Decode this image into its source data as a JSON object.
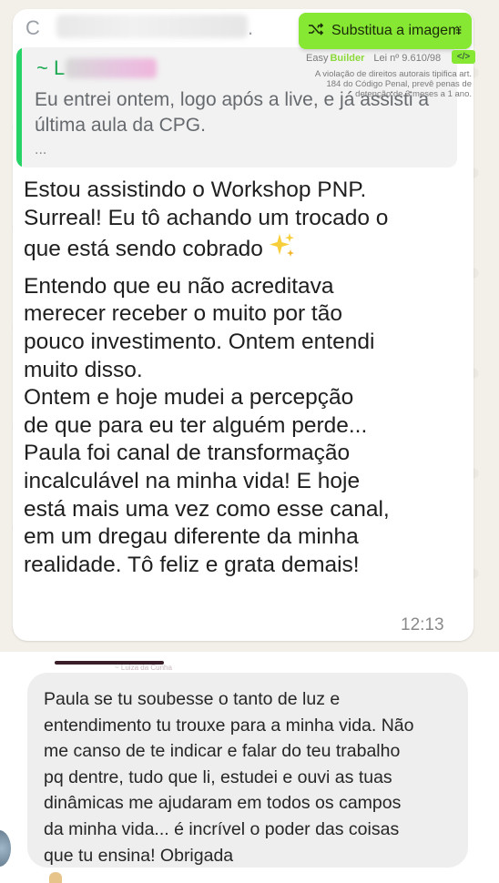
{
  "chat": {
    "sender_initial": "C",
    "sender_trail": ".",
    "quote": {
      "author_prefix": "~ L",
      "text": "Eu entrei ontem, logo após a live, e já assisti a última aula da CPG.",
      "ellipsis": "..."
    },
    "paragraphs": [
      "Estou assistindo o Workshop PNP.\nSurreal! Eu tô achando um trocado o\nque está sendo cobrado",
      "Entendo que eu não acreditava\nmerecer receber o muito por tão\npouco investimento. Ontem entendi\nmuito disso.\nOntem e hoje mudei a percepção\nde que para eu ter alguém perde...\nPaula foi canal de transformação\nincalculável na minha vida! E hoje\nestá mais uma vez como esse canal,\nem um dregau diferente da minha\nrealidade. Tô feliz e grata demais!"
    ],
    "time": "12:13"
  },
  "overlay": {
    "replace_label": "Substitua a imagem",
    "brand_prefix": "Easy",
    "brand": "Builder",
    "lei": "Lei nº 9.610/98",
    "legal_text": "A violação de direitos autorais tipifica art. 184 do Código Penal, prevê penas de detenção de 3 meses a 1 ano.",
    "code_label": "</>"
  },
  "second": {
    "divider_label": "~ Luiza da Cunha",
    "message": "Paula se tu soubesse o tanto de luz e\nentendimento tu trouxe para a minha vida. Não\nme canso de te indicar e falar do teu trabalho\npq dentre, tudo que li, estudei e ouvi as tuas\ndinâmicas me ajudaram em todos os campos\nda minha vida... é incrível o poder das coisas\nque tu ensina! Obrigada"
  },
  "colors": {
    "accent_green": "#25d366",
    "badge_green": "#86e832"
  }
}
